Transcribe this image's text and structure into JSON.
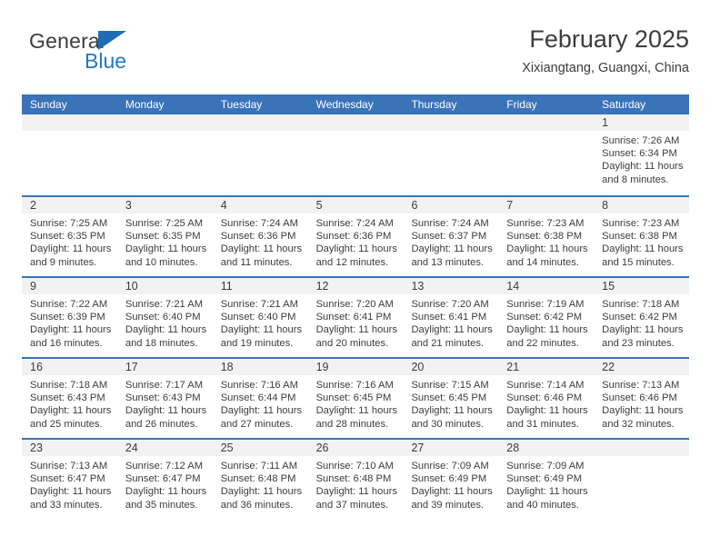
{
  "brand": {
    "name_part1": "General",
    "name_part2": "Blue",
    "accent_color": "#2079c4",
    "header_color": "#3b73b9"
  },
  "header": {
    "title": "February 2025",
    "subtitle": "Xixiangtang, Guangxi, China"
  },
  "calendar": {
    "weekdays": [
      "Sunday",
      "Monday",
      "Tuesday",
      "Wednesday",
      "Thursday",
      "Friday",
      "Saturday"
    ],
    "weeks": [
      [
        {
          "empty": true
        },
        {
          "empty": true
        },
        {
          "empty": true
        },
        {
          "empty": true
        },
        {
          "empty": true
        },
        {
          "empty": true
        },
        {
          "day": "1",
          "sunrise": "Sunrise: 7:26 AM",
          "sunset": "Sunset: 6:34 PM",
          "daylight": "Daylight: 11 hours and 8 minutes."
        }
      ],
      [
        {
          "day": "2",
          "sunrise": "Sunrise: 7:25 AM",
          "sunset": "Sunset: 6:35 PM",
          "daylight": "Daylight: 11 hours and 9 minutes."
        },
        {
          "day": "3",
          "sunrise": "Sunrise: 7:25 AM",
          "sunset": "Sunset: 6:35 PM",
          "daylight": "Daylight: 11 hours and 10 minutes."
        },
        {
          "day": "4",
          "sunrise": "Sunrise: 7:24 AM",
          "sunset": "Sunset: 6:36 PM",
          "daylight": "Daylight: 11 hours and 11 minutes."
        },
        {
          "day": "5",
          "sunrise": "Sunrise: 7:24 AM",
          "sunset": "Sunset: 6:36 PM",
          "daylight": "Daylight: 11 hours and 12 minutes."
        },
        {
          "day": "6",
          "sunrise": "Sunrise: 7:24 AM",
          "sunset": "Sunset: 6:37 PM",
          "daylight": "Daylight: 11 hours and 13 minutes."
        },
        {
          "day": "7",
          "sunrise": "Sunrise: 7:23 AM",
          "sunset": "Sunset: 6:38 PM",
          "daylight": "Daylight: 11 hours and 14 minutes."
        },
        {
          "day": "8",
          "sunrise": "Sunrise: 7:23 AM",
          "sunset": "Sunset: 6:38 PM",
          "daylight": "Daylight: 11 hours and 15 minutes."
        }
      ],
      [
        {
          "day": "9",
          "sunrise": "Sunrise: 7:22 AM",
          "sunset": "Sunset: 6:39 PM",
          "daylight": "Daylight: 11 hours and 16 minutes."
        },
        {
          "day": "10",
          "sunrise": "Sunrise: 7:21 AM",
          "sunset": "Sunset: 6:40 PM",
          "daylight": "Daylight: 11 hours and 18 minutes."
        },
        {
          "day": "11",
          "sunrise": "Sunrise: 7:21 AM",
          "sunset": "Sunset: 6:40 PM",
          "daylight": "Daylight: 11 hours and 19 minutes."
        },
        {
          "day": "12",
          "sunrise": "Sunrise: 7:20 AM",
          "sunset": "Sunset: 6:41 PM",
          "daylight": "Daylight: 11 hours and 20 minutes."
        },
        {
          "day": "13",
          "sunrise": "Sunrise: 7:20 AM",
          "sunset": "Sunset: 6:41 PM",
          "daylight": "Daylight: 11 hours and 21 minutes."
        },
        {
          "day": "14",
          "sunrise": "Sunrise: 7:19 AM",
          "sunset": "Sunset: 6:42 PM",
          "daylight": "Daylight: 11 hours and 22 minutes."
        },
        {
          "day": "15",
          "sunrise": "Sunrise: 7:18 AM",
          "sunset": "Sunset: 6:42 PM",
          "daylight": "Daylight: 11 hours and 23 minutes."
        }
      ],
      [
        {
          "day": "16",
          "sunrise": "Sunrise: 7:18 AM",
          "sunset": "Sunset: 6:43 PM",
          "daylight": "Daylight: 11 hours and 25 minutes."
        },
        {
          "day": "17",
          "sunrise": "Sunrise: 7:17 AM",
          "sunset": "Sunset: 6:43 PM",
          "daylight": "Daylight: 11 hours and 26 minutes."
        },
        {
          "day": "18",
          "sunrise": "Sunrise: 7:16 AM",
          "sunset": "Sunset: 6:44 PM",
          "daylight": "Daylight: 11 hours and 27 minutes."
        },
        {
          "day": "19",
          "sunrise": "Sunrise: 7:16 AM",
          "sunset": "Sunset: 6:45 PM",
          "daylight": "Daylight: 11 hours and 28 minutes."
        },
        {
          "day": "20",
          "sunrise": "Sunrise: 7:15 AM",
          "sunset": "Sunset: 6:45 PM",
          "daylight": "Daylight: 11 hours and 30 minutes."
        },
        {
          "day": "21",
          "sunrise": "Sunrise: 7:14 AM",
          "sunset": "Sunset: 6:46 PM",
          "daylight": "Daylight: 11 hours and 31 minutes."
        },
        {
          "day": "22",
          "sunrise": "Sunrise: 7:13 AM",
          "sunset": "Sunset: 6:46 PM",
          "daylight": "Daylight: 11 hours and 32 minutes."
        }
      ],
      [
        {
          "day": "23",
          "sunrise": "Sunrise: 7:13 AM",
          "sunset": "Sunset: 6:47 PM",
          "daylight": "Daylight: 11 hours and 33 minutes."
        },
        {
          "day": "24",
          "sunrise": "Sunrise: 7:12 AM",
          "sunset": "Sunset: 6:47 PM",
          "daylight": "Daylight: 11 hours and 35 minutes."
        },
        {
          "day": "25",
          "sunrise": "Sunrise: 7:11 AM",
          "sunset": "Sunset: 6:48 PM",
          "daylight": "Daylight: 11 hours and 36 minutes."
        },
        {
          "day": "26",
          "sunrise": "Sunrise: 7:10 AM",
          "sunset": "Sunset: 6:48 PM",
          "daylight": "Daylight: 11 hours and 37 minutes."
        },
        {
          "day": "27",
          "sunrise": "Sunrise: 7:09 AM",
          "sunset": "Sunset: 6:49 PM",
          "daylight": "Daylight: 11 hours and 39 minutes."
        },
        {
          "day": "28",
          "sunrise": "Sunrise: 7:09 AM",
          "sunset": "Sunset: 6:49 PM",
          "daylight": "Daylight: 11 hours and 40 minutes."
        },
        {
          "empty": true
        }
      ]
    ]
  }
}
